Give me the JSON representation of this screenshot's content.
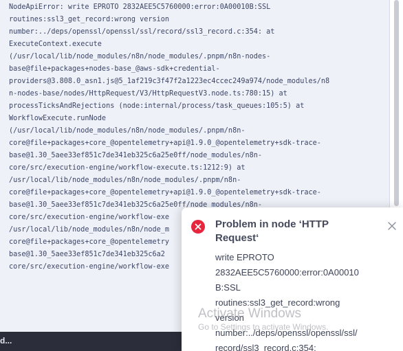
{
  "log": {
    "lines": [
      "NodeApiError: write EPROTO 2832AEE5C5760000:error:0A00010B:SSL",
      "routines:ssl3_get_record:wrong version",
      "number:../deps/openssl/openssl/ssl/record/ssl3_record.c:354: at",
      "ExecuteContext.execute",
      "(/usr/local/lib/node_modules/n8n/node_modules/.pnpm/n8n-nodes-",
      "base@file+packages+nodes-base_@aws-sdk+credential-",
      "providers@3.808.0_asn1.js@5_1af219c3f47f2a1223ec4ccec249a974/node_modules/n8",
      "n-nodes-base/nodes/HttpRequest/V3/HttpRequestV3.node.ts:780:15) at",
      "processTicksAndRejections (node:internal/process/task_queues:105:5) at",
      "WorkflowExecute.runNode",
      "(/usr/local/lib/node_modules/n8n/node_modules/.pnpm/n8n-",
      "core@file+packages+core_@opentelemetry+api@1.9.0_@opentelemetry+sdk-trace-",
      "base@1.30_5aee33ef851c7de341eb325c6a25e0ff/node_modules/n8n-",
      "core/src/execution-engine/workflow-execute.ts:1212:9) at",
      "/usr/local/lib/node_modules/n8n/node_modules/.pnpm/n8n-",
      "core@file+packages+core_@opentelemetry+api@1.9.0_@opentelemetry+sdk-trace-",
      "base@1.30_5aee33ef851c7de341eb325c6a25e0ff/node_modules/n8n-",
      "core/src/execution-engine/workflow-exe",
      "/usr/local/lib/node_modules/n8n/node_m",
      "core@file+packages+core_@opentelemetry",
      "base@1.30_5aee33ef851c7de341eb325c6a2",
      "core/src/execution-engine/workflow-exe"
    ]
  },
  "bottom_bar": {
    "label": "d..."
  },
  "toast": {
    "icon": "error-circle-x-icon",
    "title": "Problem in node ‘HTTP Request‘",
    "message_lines": [
      "write EPROTO",
      "2832AEE5C5760000:error:0A00010",
      "B:SSL",
      "routines:ssl3_get_record:wrong",
      "version",
      "number:../deps/openssl/openssl/ssl/",
      "record/ssl3_record.c:354:"
    ],
    "close_icon": "close-x-icon"
  },
  "watermark": {
    "title": "Activate Windows",
    "subtitle": "Go to Settings to activate Windows."
  },
  "colors": {
    "log_background": "#eef1f8",
    "log_text": "#3c4565",
    "error_red": "#e5263d",
    "bottom_bar": "#2b2d3a"
  }
}
